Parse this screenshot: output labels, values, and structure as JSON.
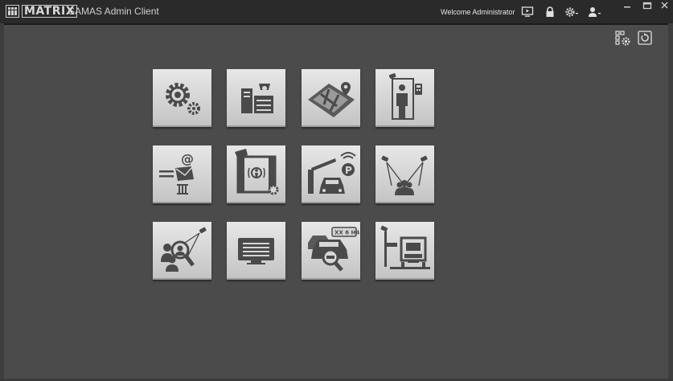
{
  "app": {
    "logo_text": "MATRIX",
    "title": "SAMAS Admin Client"
  },
  "header": {
    "welcome": "Welcome Administrator"
  },
  "icons": {
    "monitor": "monitor-play-icon",
    "lock": "lock-icon",
    "settings": "gear-dropdown-icon",
    "user": "user-dropdown-icon",
    "layout": "grid-settings-icon",
    "refresh": "refresh-icon"
  },
  "window_controls": [
    "minimize",
    "maximize",
    "close"
  ],
  "tiles": [
    "system-settings-icon",
    "server-camera-devices-icon",
    "map-site-icon",
    "door-access-control-icon",
    "email-notification-icon",
    "video-motion-analytics-icon",
    "parking-barrier-icon",
    "multi-camera-people-icon",
    "face-recognition-icon",
    "video-wall-display-icon",
    "license-plate-search-icon",
    "vehicle-weighbridge-icon"
  ],
  "colors": {
    "background": "#4b4b4b",
    "titlebar": "#2a2a2a",
    "tile": "#d6d6d6",
    "icon": "#4a4a4a"
  }
}
